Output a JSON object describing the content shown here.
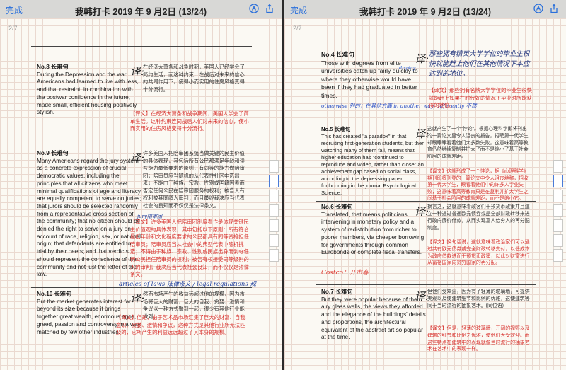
{
  "left": {
    "nav": {
      "done": "完成",
      "title": "我韩打卡 2019 年 9 月2日 (13/24)"
    },
    "page_no": "2/7",
    "s8": {
      "title": "No.8 长难句",
      "en": "During the Depression and the war, Americans had learned to live with less, and that restraint, in combination with the postwar confidence in the future, made small, efficient housing positively stylish.",
      "yi": "译:",
      "zh": "在经济大萧条和战争时期，美国人已经学会了简约生活，而这种约束，在战后对未来的信心的共同作用下，使得小而实用的住房风格变得十分流行。",
      "note": "【译文】在经济大萧条和战争期间，美国人学会了简单生活。这种约束连同战后人们对未来的信心，使小而实用的住房风格变得十分流行。"
    },
    "s9": {
      "title": "No.9 长难句",
      "en": "Many Americans regard the jury system as a concrete expression of crucial democratic values, including the principles that all citizens who meet minimal qualifications of age and literacy are equally competent to serve on juries; that jurors should be selected randomly from a representative cross section of the community; that no citizen should be denied the right to serve on a jury on account of race, religion, sex, or national origin; that defendants are entitled to trial by their peers; and that verdicts should represent the conscience of the community and not just the letter of the law.",
      "yi": "译:",
      "zh": "许多美国人把陪审团系统当做关键的民主价值的具体表现，其包括所有公民都满足年龄和读写能力最低要求的原则，有同等的能力做陪审团；陪审员应当随机的从代表性社区中选出来；不能由于种族、宗教、性别或国籍因素而否定任何公民在陪审团服务的权利；被告人有权利被其同龄人审判；而且最终裁决应当代表社会的良知而不仅仅是法律条文。",
      "note": "【译文】许多美国人把陪审团制度看作是体现关键民主价值观的具体表现，其中包括以下原则：所有符合最低年龄和文化程度要求的公民都具有同等资格担任陪审员；陪审员应当从社会中的典型代表中随机挑选；不得由于种族、宗教、性别或民族出身而剥夺任何公民担任陪审员的权利；被告有权接受同等级别的人的审判；裁决应当代表社会良知，而不仅仅是法律条文。",
      "hand_jury": "jury陪审团",
      "hand_articles": "articles of laws 法律条文 / legal regulations 规"
    },
    "s10": {
      "title": "No.10 长难句",
      "en": "But the market generates interest far beyond its size because it brings together great wealth, enormous egos, greed, passion and controversy in a way matched by few other industries.",
      "yi": "译:",
      "zh": "然而市场产生的收益远超过他的规模，因为市场将巨大的财富，巨大的自我、贪婪、激情和争议以一种方式聚到一起，很少有其他行业能做到。",
      "note": "【译文】但是，由于艺术品市场汇集了巨大的财富、自我意识、贪婪、激情和争议，这种方式是其他行业所无法匹及的，它所产生的利益远远超过了其本身的规模。"
    }
  },
  "right": {
    "nav": {
      "done": "完成",
      "title": "我韩打卡 2019 年 9 月2日 (13/24)"
    },
    "page_no": "2/7",
    "s4": {
      "title": "No.4 长难句",
      "en": "Those with degrees from elite universities catch up fairly quickly to where they otherwise would have been if they had graduated in better times.",
      "yi": "译:",
      "hand_zh": "那些拥有精英大学学位的毕业生很快就能赶上他们在其他情况下本应达到的地位。",
      "hand_otherwise": "otherwise 别的；在其他方面 in another way, differently 不然",
      "hand_display": "display",
      "note": "【译文】那些拥有名牌大学学位的毕业生很快就能赶上如果在时代好的情况下毕业时所能获得的地位。"
    },
    "s5": {
      "title": "No.5 长难句",
      "en": "This has created \"a paradox\" in that recruiting first-generation students, but then watching many of them fail, means that higher education has \"continued to reproduce and widen, rather than close\" an achievement gap based on social class, according to the depressing paper, forthcoming in the journal Psychological Science.",
      "yi": "译:",
      "zh": "这就产生了一个\"悖论\"。根据心理科学即将刊出的一篇论文里令人沮丧的报告，招聘第一代学生却眼睁睁看着他们大多数失败，这意味着高等教育仍然继续复制并扩大了而不是缩小了基于社会阶层的成就差距。",
      "note": "【译文】这就形成了一个悖论，据《心理科学》期刊即将刊登的一篇论文中令人沮丧地称，招收第一代大学生，眼看着他们中的许多人学业失败，这意味着高等教育只是在复制并扩大学生之间基于社会阶层的成就差距，而不是缩小它。"
    },
    "s6": {
      "title": "No.6 长难句",
      "en": "Translated, that means politicians intervening in monetary policy and a system of redistribution from richer to poorer members, via cheaper borrowing for governments through common Eurobonds or complete fiscal transfers.",
      "yi": "译:",
      "zh": "换言之，这就意味着政客们干预货币政策并且建立一种通过普通欧元债券或是全部财政转移来进行政府廉价借款，从而实现富人给穷人的再分配制度。",
      "note": "【译文】换句话说，这就意味着政治家们可以通过共有欧元债券或完全财政转移支付，以低成本为政府借款进而干预货币政策，以此对财富进行从富裕国家向贫穷国家的再分配。",
      "hand_costco": "Costco：开市客"
    },
    "s7": {
      "title": "No.7 长难句",
      "en": "But they were popular because of their airy glass walls, the views they afforded and the elegance of the buildings' details and proportions, the architectural equivalent of the abstract art so popular at the time.",
      "yi": "译:",
      "zh": "但他们受欢迎，因为有了轻薄的玻璃墙，可提供美观以及使建筑细节和比例的优雅，这使建筑等同于当时流行的抽象艺术。(同位语)",
      "note": "【译文】但是，轻薄的玻璃墙，开阔的视野以及建筑的细节和比例之优雅，使他们大受欢迎。而这些特点在建筑中的表现就像当时流行的抽象艺术在艺术中的表现一样。"
    }
  }
}
